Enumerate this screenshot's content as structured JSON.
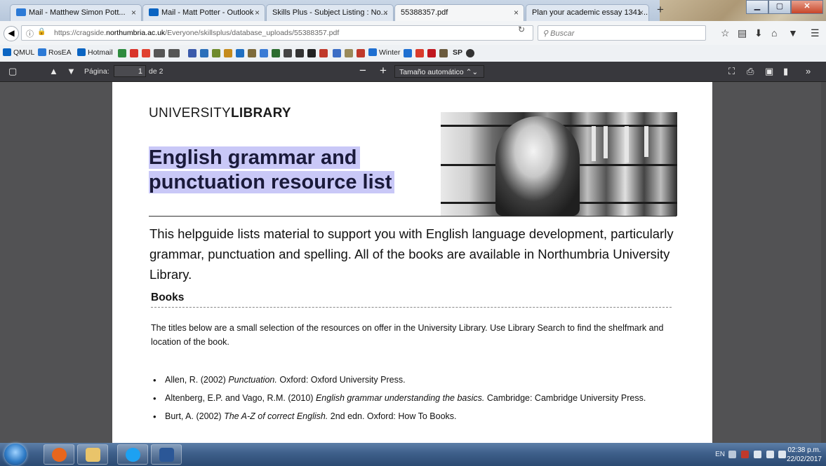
{
  "browser": {
    "tabs": [
      {
        "label": "Mail - Matthew Simon Pott...",
        "icon_color": "#2c7ad6"
      },
      {
        "label": "Mail - Matt Potter - Outlook",
        "icon_color": "#0a64c2"
      },
      {
        "label": "Skills Plus - Subject Listing : No...",
        "icon_color": "#888888"
      },
      {
        "label": "55388357.pdf",
        "icon_color": "#888888"
      },
      {
        "label": "Plan your academic essay 1341 ...",
        "icon_color": "#888888"
      }
    ],
    "url": {
      "prefix": "https://cragside.",
      "domain": "northumbria.ac.uk",
      "path": "/Everyone/skillsplus/database_uploads/55388357.pdf"
    },
    "search_placeholder": "Buscar"
  },
  "bookmarks": [
    {
      "label": "QMUL",
      "color": "#0a64c2"
    },
    {
      "label": "RosEA",
      "color": "#2c7ad6"
    },
    {
      "label": "Hotmail",
      "color": "#0a64c2"
    },
    {
      "label": "Winter",
      "color": "#1e6fd1"
    },
    {
      "label": "SP",
      "color": "#1a1a1a"
    }
  ],
  "pdf_toolbar": {
    "page_label": "Página:",
    "page_value": "1",
    "page_of": "de 2",
    "zoom_minus": "−",
    "zoom_plus": "+",
    "zoom_label": "Tamaño automático"
  },
  "document": {
    "brand_light": "UNIVERSITY",
    "brand_bold": "LIBRARY",
    "title": "English grammar and punctuation resource list",
    "intro": "This helpguide lists material to support you with English language development, particularly grammar, punctuation and spelling. All of the books are available in Northumbria University Library.",
    "books_heading": "Books",
    "books_paragraph": "The titles below are a small selection of the resources on offer in the University Library. Use Library Search to find the shelfmark and location of the book.",
    "references": [
      {
        "author": "Allen, R. (2002)",
        "title": "Punctuation.",
        "rest": "Oxford: Oxford University Press."
      },
      {
        "author": "Altenberg, E.P. and Vago, R.M. (2010)",
        "title": "English grammar understanding the basics.",
        "rest": "Cambridge: Cambridge University Press."
      },
      {
        "author": "Burt, A. (2002)",
        "title": "The A-Z of correct English.",
        "rest": "2nd edn. Oxford: How To Books."
      }
    ]
  },
  "taskbar": {
    "language": "EN",
    "time": "02:38 p.m.",
    "date": "22/02/2017",
    "apps": [
      {
        "name": "firefox",
        "color": "#e8661c"
      },
      {
        "name": "explorer",
        "color": "#e9c46a"
      },
      {
        "name": "skype",
        "color": "#1da1f2"
      },
      {
        "name": "word",
        "color": "#2b5797"
      }
    ]
  }
}
